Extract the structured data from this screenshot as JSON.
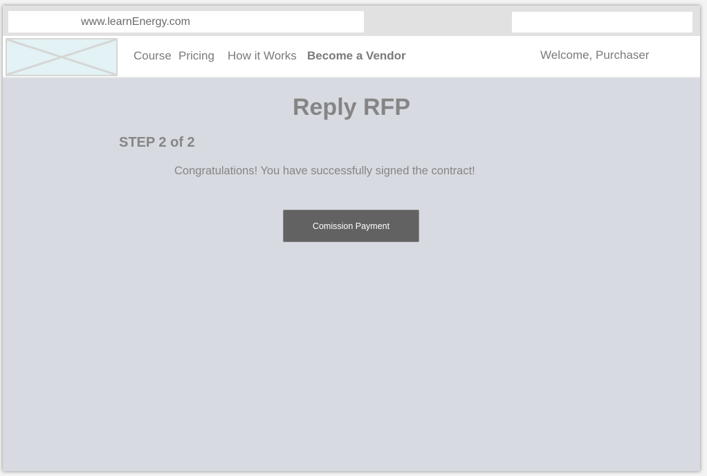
{
  "browser": {
    "url": "www.learnEnergy.com"
  },
  "nav": {
    "logo_icon": "image-placeholder-icon",
    "items": [
      {
        "label": "Course"
      },
      {
        "label": "Pricing"
      },
      {
        "label": "How it Works"
      },
      {
        "label": "Become a Vendor"
      }
    ],
    "welcome": "Welcome, Purchaser"
  },
  "main": {
    "title": "Reply RFP",
    "step": "STEP 2 of 2",
    "message": "Congratulations! You have successfully signed the contract!",
    "button_label": "Comission Payment"
  },
  "colors": {
    "page_background": "#d7dae1",
    "button_background": "#626262",
    "text_gray": "#858585"
  }
}
